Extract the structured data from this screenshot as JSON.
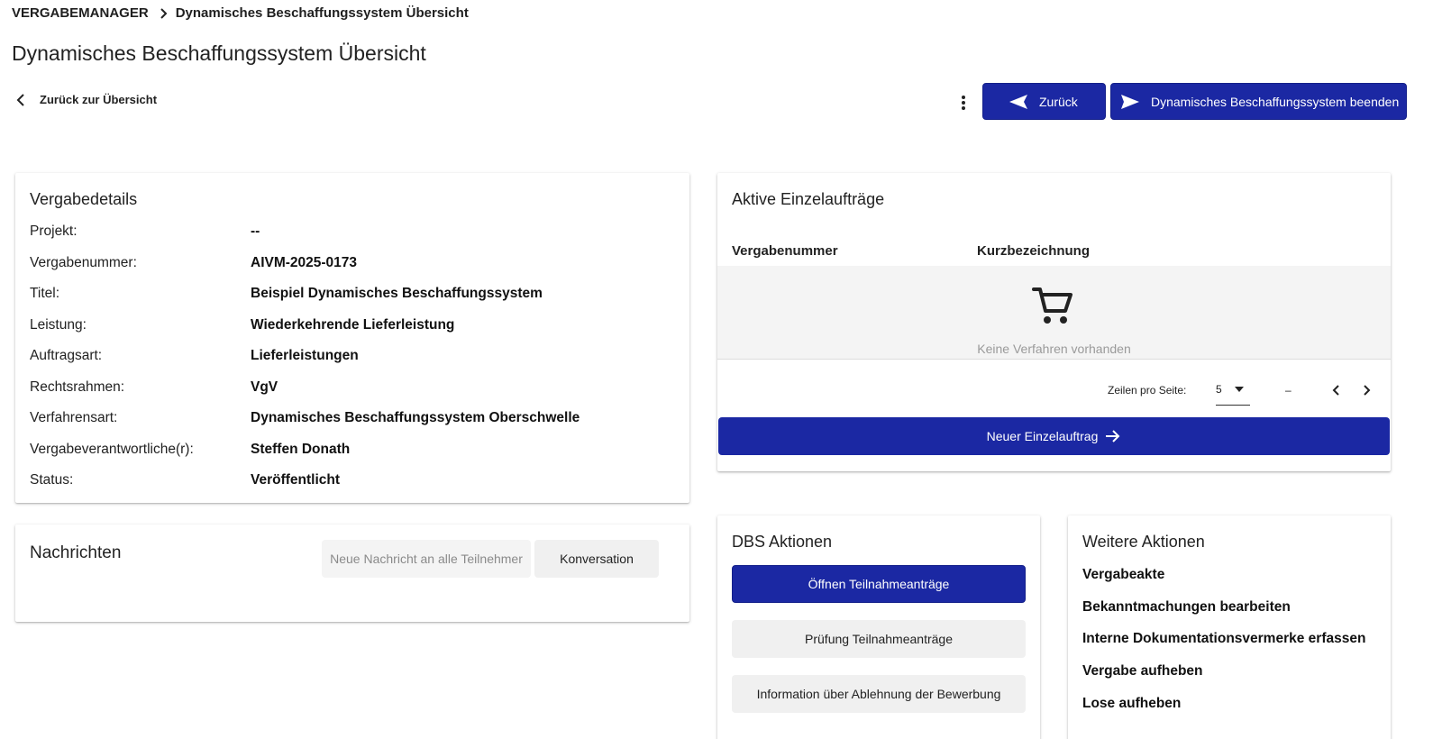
{
  "breadcrumb": {
    "root": "VERGABEMANAGER",
    "current": "Dynamisches Beschaffungssystem Übersicht"
  },
  "page_title": "Dynamisches Beschaffungssystem Übersicht",
  "back_link": "Zurück zur Übersicht",
  "header_actions": {
    "back_label": "Zurück",
    "end_label": "Dynamisches Beschaffungssystem beenden",
    "more_icon": "more-vert-icon"
  },
  "details": {
    "title": "Vergabedetails",
    "rows": [
      {
        "key": "Projekt:",
        "value": "--"
      },
      {
        "key": "Vergabenummer:",
        "value": "AIVM-2025-0173"
      },
      {
        "key": "Titel:",
        "value": "Beispiel Dynamisches Beschaffungssystem"
      },
      {
        "key": "Leistung:",
        "value": "Wiederkehrende Lieferleistung"
      },
      {
        "key": "Auftragsart:",
        "value": "Lieferleistungen"
      },
      {
        "key": "Rechtsrahmen:",
        "value": "VgV"
      },
      {
        "key": "Verfahrensart:",
        "value": "Dynamisches Beschaffungssystem Oberschwelle"
      },
      {
        "key": "Vergabeverantwortliche(r):",
        "value": "Steffen Donath"
      },
      {
        "key": "Status:",
        "value": "Veröffentlicht"
      }
    ]
  },
  "messages": {
    "title": "Nachrichten",
    "input_placeholder": "Neue Nachricht an alle Teilnehmer",
    "conversation_label": "Konversation"
  },
  "orders": {
    "title": "Aktive Einzelaufträge",
    "columns": [
      "Vergabenummer",
      "Kurzbezeichnung",
      ""
    ],
    "empty_text": "Keine Verfahren vorhanden",
    "rows_per_page_label": "Zeilen pro Seite:",
    "rows_per_page_value": "5",
    "range_text": "–",
    "new_order_label": "Neuer Einzelauftrag"
  },
  "dbs_actions": {
    "title": "DBS Aktionen",
    "buttons": [
      "Öffnen Teilnahmeanträge",
      "Prüfung Teilnahmeanträge",
      "Information über Ablehnung der Bewerbung"
    ]
  },
  "more_actions": {
    "title": "Weitere Aktionen",
    "links": [
      "Vergabeakte",
      "Bekanntmachungen bearbeiten",
      "Interne Dokumentationsvermerke erfassen",
      "Vergabe aufheben",
      "Lose aufheben"
    ]
  },
  "colors": {
    "primary": "#1b28a3",
    "surface_muted": "#f4f4f4"
  }
}
